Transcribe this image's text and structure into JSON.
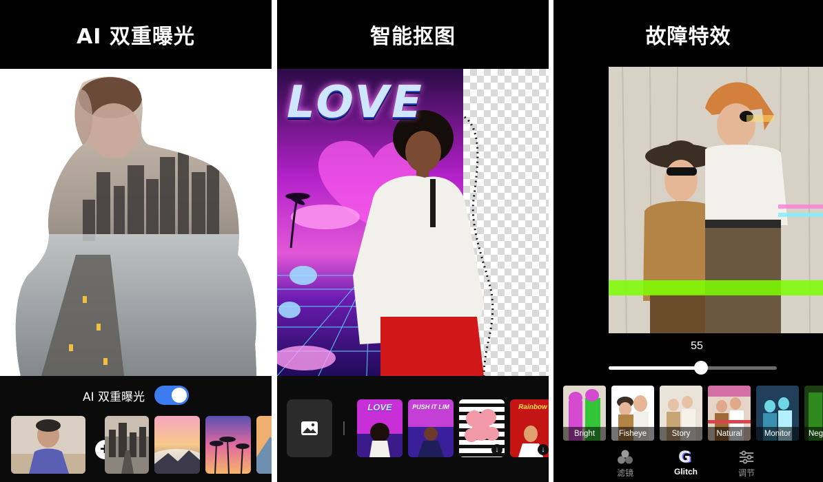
{
  "panels": {
    "double_exposure": {
      "title": "AI 双重曝光",
      "toggle_label": "AI 双重曝光",
      "toggle_on": true,
      "plus_symbol": "+"
    },
    "cutout": {
      "title": "智能抠图",
      "photo_text": "LOVE",
      "template_texts": [
        "LOVE",
        "PUSH IT LIM",
        "Rainbow"
      ]
    },
    "glitch": {
      "title": "故障特效",
      "slider_value": "55",
      "slider_fraction": 0.55,
      "filters": [
        "Bright",
        "Fisheye",
        "Story",
        "Natural",
        "Monitor",
        "Neg"
      ],
      "tabs": [
        "滤镜",
        "Glitch",
        "调节"
      ],
      "active_tab": "Glitch"
    }
  },
  "colors": {
    "toggle_on": "#3d7cf0",
    "panel_bg": "#000000",
    "glitch_accent": "#7dff00"
  },
  "icons": [
    "plus-icon",
    "image-icon",
    "download-icon",
    "filter-circles-icon",
    "glitch-g-icon",
    "sliders-icon"
  ]
}
